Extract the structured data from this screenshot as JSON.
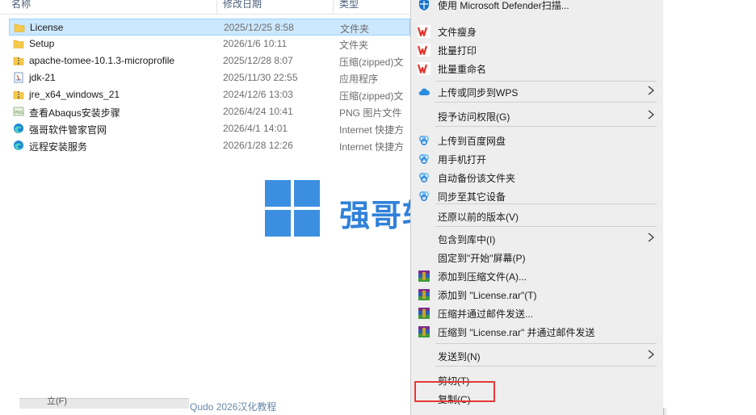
{
  "header": {
    "name_label": "名称",
    "date_label": "修改日期",
    "type_label": "类型"
  },
  "files": [
    {
      "name": "License",
      "date": "2025/12/25 8:58",
      "type": "文件夹",
      "icon": "folder-icon",
      "selected": true
    },
    {
      "name": "Setup",
      "date": "2026/1/6 10:11",
      "type": "文件夹",
      "icon": "folder-icon"
    },
    {
      "name": "apache-tomee-10.1.3-microprofile",
      "date": "2025/12/28 8:07",
      "type": "压缩(zipped)文",
      "icon": "zip-folder-icon"
    },
    {
      "name": "jdk-21",
      "date": "2025/11/30 22:55",
      "type": "应用程序",
      "icon": "installer-icon"
    },
    {
      "name": "jre_x64_windows_21",
      "date": "2024/12/6 13:03",
      "type": "压缩(zipped)文",
      "icon": "zip-folder-icon"
    },
    {
      "name": "查看Abaqus安装步骤",
      "date": "2026/4/24 10:41",
      "type": "PNG 图片文件",
      "icon": "png-image-icon"
    },
    {
      "name": "强哥软件管家官网",
      "date": "2026/4/1 14:01",
      "type": "Internet 快捷方",
      "icon": "edge-icon"
    },
    {
      "name": "远程安装服务",
      "date": "2026/1/28 12:26",
      "type": "Internet 快捷方",
      "icon": "edge-icon"
    }
  ],
  "bottom": {
    "left_text": "立(F)",
    "right_text": "Qudo 2026汉化教程"
  },
  "watermark": {
    "text": "强哥软件管家"
  },
  "menu": {
    "items": [
      {
        "label": "使用 Microsoft Defender扫描...",
        "icon": "defender-icon"
      },
      {
        "label": "文件瘦身",
        "icon": "wps-icon"
      },
      {
        "label": "批量打印",
        "icon": "wps-icon"
      },
      {
        "label": "批量重命名",
        "icon": "wps-icon"
      },
      {
        "label": "上传或同步到WPS",
        "icon": "wps-cloud-icon",
        "submenu": true
      },
      {
        "label": "授予访问权限(G)",
        "icon": "",
        "submenu": true
      },
      {
        "label": "上传到百度网盘",
        "icon": "baidu-netdisk-icon"
      },
      {
        "label": "用手机打开",
        "icon": "baidu-netdisk-icon"
      },
      {
        "label": "自动备份该文件夹",
        "icon": "baidu-netdisk-icon"
      },
      {
        "label": "同步至其它设备",
        "icon": "baidu-netdisk-icon"
      },
      {
        "label": "还原以前的版本(V)",
        "icon": ""
      },
      {
        "label": "包含到库中(I)",
        "icon": "",
        "submenu": true
      },
      {
        "label": "固定到\"开始\"屏幕(P)",
        "icon": ""
      },
      {
        "label": "添加到压缩文件(A)...",
        "icon": "winrar-icon"
      },
      {
        "label": "添加到 \"License.rar\"(T)",
        "icon": "winrar-icon"
      },
      {
        "label": "压缩并通过邮件发送...",
        "icon": "winrar-icon"
      },
      {
        "label": "压缩到 \"License.rar\" 并通过邮件发送",
        "icon": "winrar-icon"
      },
      {
        "label": "发送到(N)",
        "icon": "",
        "submenu": true
      },
      {
        "label": "剪切(T)",
        "icon": ""
      },
      {
        "label": "复制(C)",
        "icon": ""
      }
    ]
  },
  "colors": {
    "selection": "#cce8ff",
    "menu_bg": "#eeeeee",
    "highlight_box": "#e53935",
    "watermark": "#1f77d6",
    "wps_red": "#e4352d"
  }
}
